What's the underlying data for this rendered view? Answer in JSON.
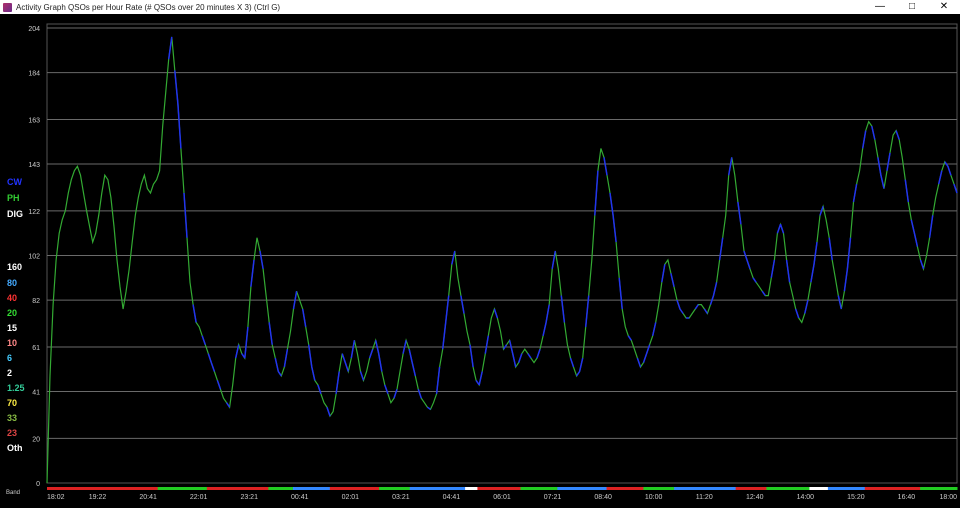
{
  "window": {
    "title": "Activity Graph   QSOs per Hour Rate  (# QSOs over 20 minutes X 3)  (Ctrl G)",
    "minimize": "—",
    "maximize": "□",
    "close": "✕"
  },
  "legend": [
    {
      "label": "CW",
      "color": "#2233ff"
    },
    {
      "label": "PH",
      "color": "#33cc33"
    },
    {
      "label": "DIG",
      "color": "#ffffff"
    },
    {
      "label": "160",
      "color": "#ffffff"
    },
    {
      "label": "80",
      "color": "#44aaff"
    },
    {
      "label": "40",
      "color": "#ff3333"
    },
    {
      "label": "20",
      "color": "#33dd33"
    },
    {
      "label": "15",
      "color": "#ffffff"
    },
    {
      "label": "10",
      "color": "#ff8888"
    },
    {
      "label": "6",
      "color": "#44ccff"
    },
    {
      "label": "2",
      "color": "#ffffff"
    },
    {
      "label": "1.25",
      "color": "#33cc99"
    },
    {
      "label": "70",
      "color": "#ffee44"
    },
    {
      "label": "33",
      "color": "#88bb44"
    },
    {
      "label": "23",
      "color": "#dd4444"
    },
    {
      "label": "Oth",
      "color": "#ffffff"
    }
  ],
  "band_label": "Band",
  "chart_data": {
    "type": "line",
    "title": "QSOs per Hour Rate",
    "xlabel": "",
    "ylabel": "",
    "ylim": [
      0,
      204
    ],
    "y_ticks": [
      "0",
      "20",
      "41",
      "61",
      "82",
      "102",
      "122",
      "143",
      "163",
      "184",
      "204"
    ],
    "x_ticks": [
      "18:02",
      "19:22",
      "20:41",
      "22:01",
      "23:21",
      "00:41",
      "02:01",
      "03:21",
      "04:41",
      "06:01",
      "07:21",
      "08:40",
      "10:00",
      "11:20",
      "12:40",
      "14:00",
      "15:20",
      "16:40",
      "18:00"
    ],
    "grid": true,
    "series": [
      {
        "name": "PH",
        "color": "#33aa33",
        "values": [
          0,
          48,
          80,
          100,
          112,
          118,
          122,
          130,
          136,
          140,
          142,
          138,
          130,
          122,
          115,
          108,
          112,
          120,
          130,
          138,
          136,
          128,
          115,
          100,
          88,
          78,
          86,
          96,
          108,
          120,
          128,
          134,
          138,
          132,
          130,
          134,
          136,
          140,
          160,
          175,
          190,
          200,
          185,
          170,
          150,
          130,
          110,
          90,
          80,
          72,
          70,
          66,
          62,
          58,
          54,
          50,
          46,
          42,
          38,
          36,
          34,
          44,
          56,
          62,
          58,
          56,
          70,
          88,
          100,
          110,
          104,
          96,
          84,
          72,
          62,
          56,
          50,
          48,
          52,
          60,
          68,
          78,
          86,
          82,
          78,
          70,
          62,
          52,
          46,
          44,
          40,
          36,
          34,
          30,
          32,
          40,
          50,
          58,
          54,
          50,
          56,
          64,
          58,
          50,
          46,
          50,
          56,
          60,
          64,
          58,
          50,
          44,
          40,
          36,
          38,
          42,
          50,
          58,
          64,
          60,
          54,
          48,
          42,
          38,
          36,
          34,
          33,
          36,
          40,
          52,
          60,
          72,
          84,
          98,
          104,
          92,
          84,
          76,
          68,
          62,
          52,
          46,
          44,
          50,
          58,
          66,
          74,
          78,
          74,
          68,
          60,
          62,
          64,
          58,
          52,
          54,
          58,
          60,
          58,
          56,
          54,
          56,
          60,
          66,
          72,
          80,
          96,
          104,
          96,
          84,
          72,
          62,
          56,
          52,
          48,
          50,
          56,
          70,
          84,
          100,
          120,
          140,
          150,
          146,
          138,
          130,
          120,
          108,
          92,
          78,
          70,
          66,
          64,
          60,
          56,
          52,
          54,
          58,
          62,
          66,
          72,
          80,
          90,
          98,
          100,
          94,
          88,
          82,
          78,
          76,
          74,
          74,
          76,
          78,
          80,
          80,
          78,
          76,
          80,
          84,
          90,
          100,
          110,
          120,
          138,
          146,
          138,
          126,
          116,
          104,
          100,
          96,
          92,
          90,
          88,
          86,
          84,
          84,
          92,
          100,
          112,
          116,
          112,
          100,
          90,
          84,
          78,
          74,
          72,
          76,
          82,
          90,
          98,
          108,
          120,
          124,
          118,
          110,
          100,
          92,
          84,
          78,
          86,
          96,
          110,
          126,
          134,
          140,
          150,
          158,
          162,
          160,
          154,
          146,
          138,
          132,
          140,
          148,
          156,
          158,
          154,
          146,
          136,
          126,
          118,
          112,
          106,
          100,
          96,
          102,
          110,
          120,
          128,
          134,
          140,
          144,
          142,
          138,
          134,
          130
        ],
        "note": "Green phone activity line"
      },
      {
        "name": "CW",
        "color": "#2233ee",
        "values": [
          0,
          48,
          80,
          100,
          112,
          118,
          122,
          130,
          136,
          140,
          142,
          138,
          130,
          122,
          115,
          108,
          112,
          120,
          130,
          138,
          136,
          128,
          115,
          100,
          88,
          78,
          86,
          96,
          108,
          120,
          128,
          134,
          138,
          132,
          130,
          134,
          136,
          140,
          160,
          175,
          190,
          200,
          185,
          170,
          150,
          130,
          110,
          90,
          80,
          72,
          70,
          66,
          62,
          58,
          54,
          50,
          46,
          42,
          38,
          36,
          34,
          44,
          56,
          62,
          58,
          56,
          70,
          88,
          100,
          110,
          104,
          96,
          84,
          72,
          62,
          56,
          50,
          48,
          52,
          60,
          68,
          78,
          86,
          82,
          78,
          70,
          62,
          52,
          46,
          44,
          40,
          36,
          34,
          30,
          32,
          40,
          50,
          58,
          54,
          50,
          56,
          64,
          58,
          50,
          46,
          50,
          56,
          60,
          64,
          58,
          50,
          44,
          40,
          36,
          38,
          42,
          50,
          58,
          64,
          60,
          54,
          48,
          42,
          38,
          36,
          34,
          33,
          36,
          40,
          52,
          60,
          72,
          84,
          98,
          104,
          92,
          84,
          76,
          68,
          62,
          52,
          46,
          44,
          50,
          58,
          66,
          74,
          78,
          74,
          68,
          60,
          62,
          64,
          58,
          52,
          54,
          58,
          60,
          58,
          56,
          54,
          56,
          60,
          66,
          72,
          80,
          96,
          104,
          96,
          84,
          72,
          62,
          56,
          52,
          48,
          50,
          56,
          70,
          84,
          100,
          120,
          140,
          150,
          146,
          138,
          130,
          120,
          108,
          92,
          78,
          70,
          66,
          64,
          60,
          56,
          52,
          54,
          58,
          62,
          66,
          72,
          80,
          90,
          98,
          100,
          94,
          88,
          82,
          78,
          76,
          74,
          74,
          76,
          78,
          80,
          80,
          78,
          76,
          80,
          84,
          90,
          100,
          110,
          120,
          138,
          146,
          138,
          126,
          116,
          104,
          100,
          96,
          92,
          90,
          88,
          86,
          84,
          84,
          92,
          100,
          112,
          116,
          112,
          100,
          90,
          84,
          78,
          74,
          72,
          76,
          82,
          90,
          98,
          108,
          120,
          124,
          118,
          110,
          100,
          92,
          84,
          78,
          86,
          96,
          110,
          126,
          134,
          140,
          150,
          158,
          162,
          160,
          154,
          146,
          138,
          132,
          140,
          148,
          156,
          158,
          154,
          146,
          136,
          126,
          118,
          112,
          106,
          100,
          96,
          102,
          110,
          120,
          128,
          134,
          140,
          144,
          142,
          138,
          134,
          130
        ],
        "note": "Blue CW segments overlaid"
      }
    ]
  },
  "band_strip": {
    "segments": [
      {
        "color": "#dd2222",
        "weight": 18
      },
      {
        "color": "#22cc22",
        "weight": 8
      },
      {
        "color": "#dd2222",
        "weight": 10
      },
      {
        "color": "#22cc22",
        "weight": 4
      },
      {
        "color": "#3388ff",
        "weight": 6
      },
      {
        "color": "#dd2222",
        "weight": 8
      },
      {
        "color": "#22cc22",
        "weight": 5
      },
      {
        "color": "#3388ff",
        "weight": 9
      },
      {
        "color": "#ffffff",
        "weight": 2
      },
      {
        "color": "#dd2222",
        "weight": 7
      },
      {
        "color": "#22cc22",
        "weight": 6
      },
      {
        "color": "#3388ff",
        "weight": 8
      },
      {
        "color": "#dd2222",
        "weight": 6
      },
      {
        "color": "#22cc22",
        "weight": 5
      },
      {
        "color": "#3388ff",
        "weight": 10
      },
      {
        "color": "#dd2222",
        "weight": 5
      },
      {
        "color": "#22cc22",
        "weight": 7
      },
      {
        "color": "#ffffff",
        "weight": 3
      },
      {
        "color": "#3388ff",
        "weight": 6
      },
      {
        "color": "#dd2222",
        "weight": 9
      },
      {
        "color": "#22cc22",
        "weight": 6
      }
    ]
  }
}
